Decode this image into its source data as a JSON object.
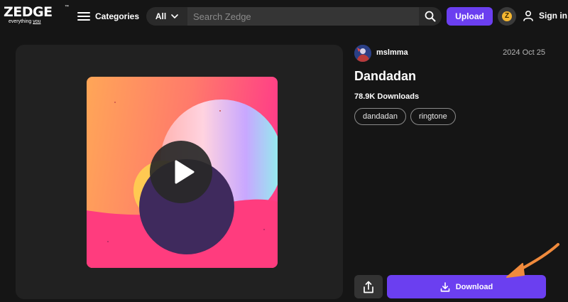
{
  "header": {
    "logo": {
      "word": "ZEDGE",
      "tm": "™",
      "tagline_pre": "everything ",
      "tagline_u": "you"
    },
    "categories_label": "Categories",
    "search": {
      "scope": "All",
      "placeholder": "Search Zedge",
      "value": ""
    },
    "upload_label": "Upload",
    "zcoin_symbol": "Z",
    "signin_label": "Sign in"
  },
  "item": {
    "author": "mslmma",
    "date": "2024 Oct 25",
    "title": "Dandadan",
    "downloads": "78.9K Downloads",
    "tags": [
      {
        "label": "dandadan"
      },
      {
        "label": "ringtone"
      }
    ],
    "download_label": "Download"
  },
  "colors": {
    "accent": "#6b3ff0",
    "background": "#151515",
    "card": "#212121",
    "annotation_arrow": "#f08a3c"
  },
  "icons": {
    "menu": "hamburger-icon",
    "search": "search-icon",
    "user": "user-icon",
    "play": "play-icon",
    "share": "share-icon",
    "download": "download-icon"
  }
}
